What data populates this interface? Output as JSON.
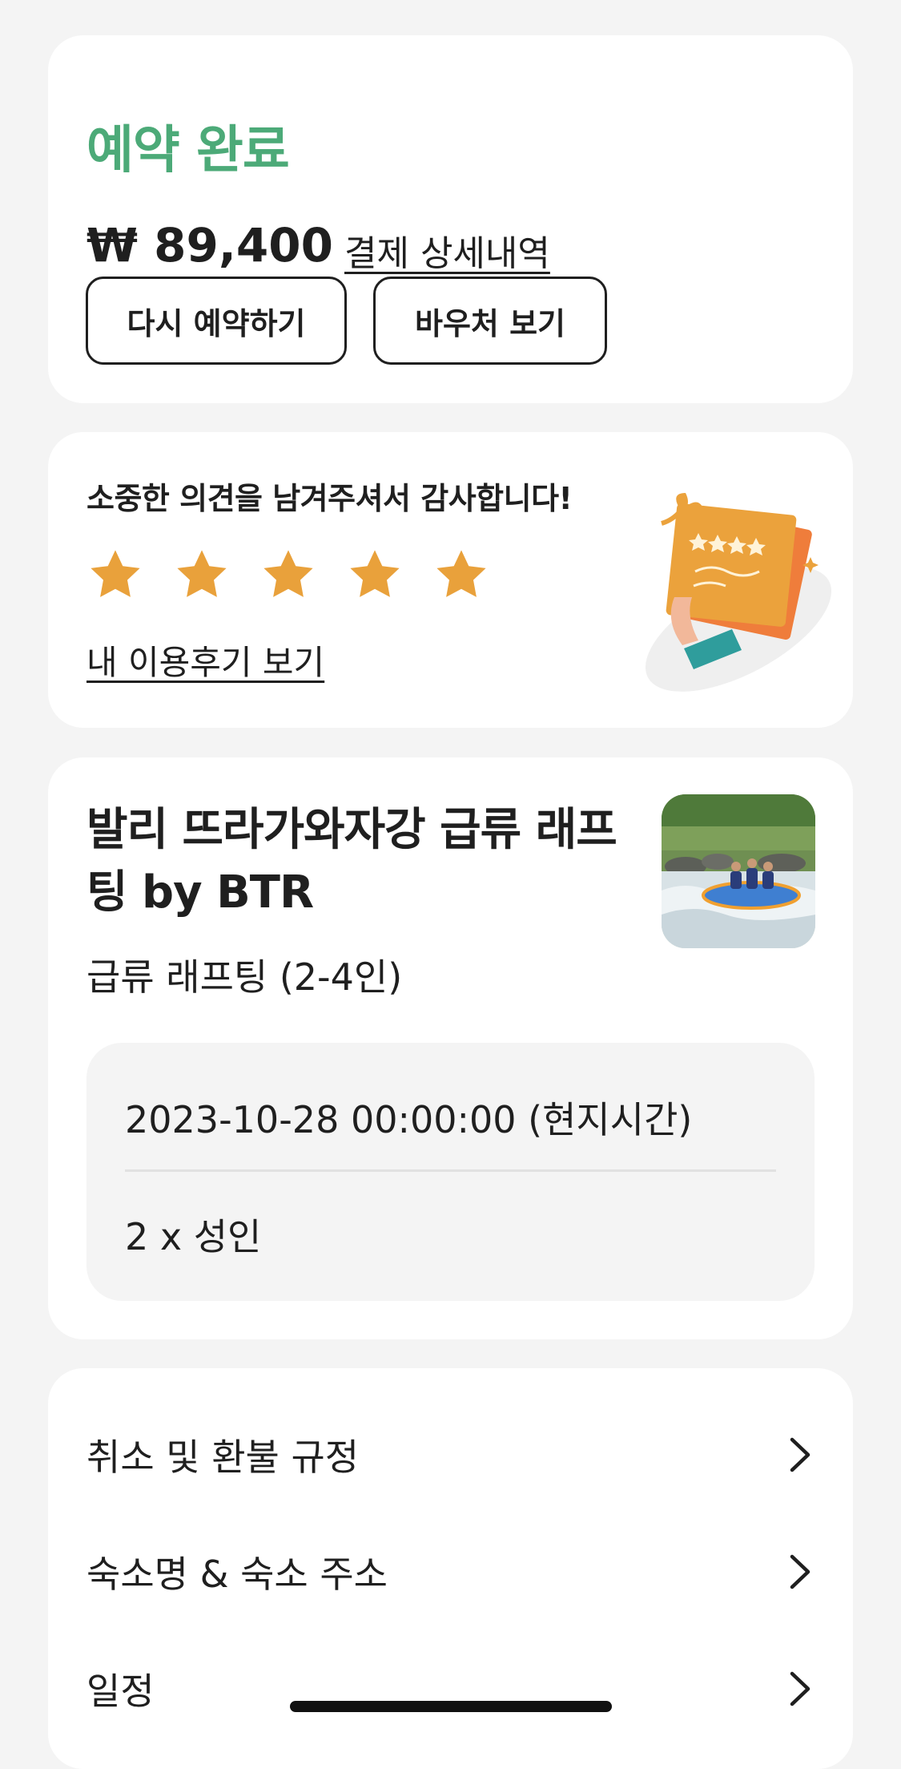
{
  "booking": {
    "status": "예약 완료",
    "price": "₩ 89,400",
    "payment_detail_link": "결제 상세내역",
    "rebook_button": "다시 예약하기",
    "voucher_button": "바우처 보기"
  },
  "review": {
    "message": "소중한 의견을 남겨주셔서 감사합니다!",
    "rating": 5,
    "rating_max": 5,
    "view_review_link": "내 이용후기 보기"
  },
  "product": {
    "title": "발리 뜨라가와자강 급류 래프팅 by BTR",
    "option": "급류 래프팅 (2-4인)",
    "datetime": "2023-10-28 00:00:00 (현지시간)",
    "quantity": "2 x 성인"
  },
  "menu": {
    "items": [
      {
        "label": "취소 및 환불 규정"
      },
      {
        "label": "숙소명 & 숙소 주소"
      },
      {
        "label": "일정"
      }
    ]
  },
  "colors": {
    "accent_green": "#4caa78",
    "star_orange": "#e9a13b",
    "background": "#f4f4f4"
  },
  "icons": {
    "star": "star-icon",
    "chevron": "chevron-right-icon"
  }
}
